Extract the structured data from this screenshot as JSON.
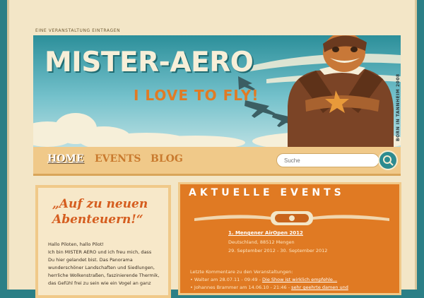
{
  "top_link": "EINE VERANSTALTUNG EINTRAGEN",
  "banner": {
    "title": "MISTER-AERO",
    "tagline": "I LOVE TO FLY!",
    "born_label": "BORN IN TANNHEIM 2008"
  },
  "nav": {
    "items": [
      "HOME",
      "EVENTS",
      "BLOG"
    ],
    "search_placeholder": "Suche"
  },
  "welcome": {
    "heading": "„Auf zu neuen Abenteuern!“",
    "lines": [
      "Hallo Piloten, hallo Pilot!",
      "Ich bin MISTER AERO und ich freu mich, dass",
      "Du hier gelandet bist. Das Panorama",
      "wunderschöner Landschaften und Siedlungen,",
      "herrliche Wolkenstraßen, faszinierende Thermik,",
      "das Gefühl frei zu sein wie ein Vogel an ganz"
    ]
  },
  "events": {
    "heading": "AKTUELLE EVENTS",
    "event_title": "1. Mengener AirOpen 2012",
    "event_location": "Deutschland, 88512 Mengen",
    "event_date": "29. September 2012 - 30. September 2012",
    "comments_label": "Letzte Kommentare zu den Veranstaltungen:",
    "comments": [
      {
        "prefix": "Walter am 28.07.11 - 09:49 - ",
        "link": "Die Show ist wirklich empfehle..."
      },
      {
        "prefix": "Johannes Brammer am 14.06.10 - 21:46 - ",
        "link": "sehr geehrte damen und"
      }
    ]
  },
  "colors": {
    "sky": "#2c8f9a",
    "accent_orange": "#e07a23",
    "cream": "#f3e6c7",
    "nav_bar": "#f0c989"
  }
}
